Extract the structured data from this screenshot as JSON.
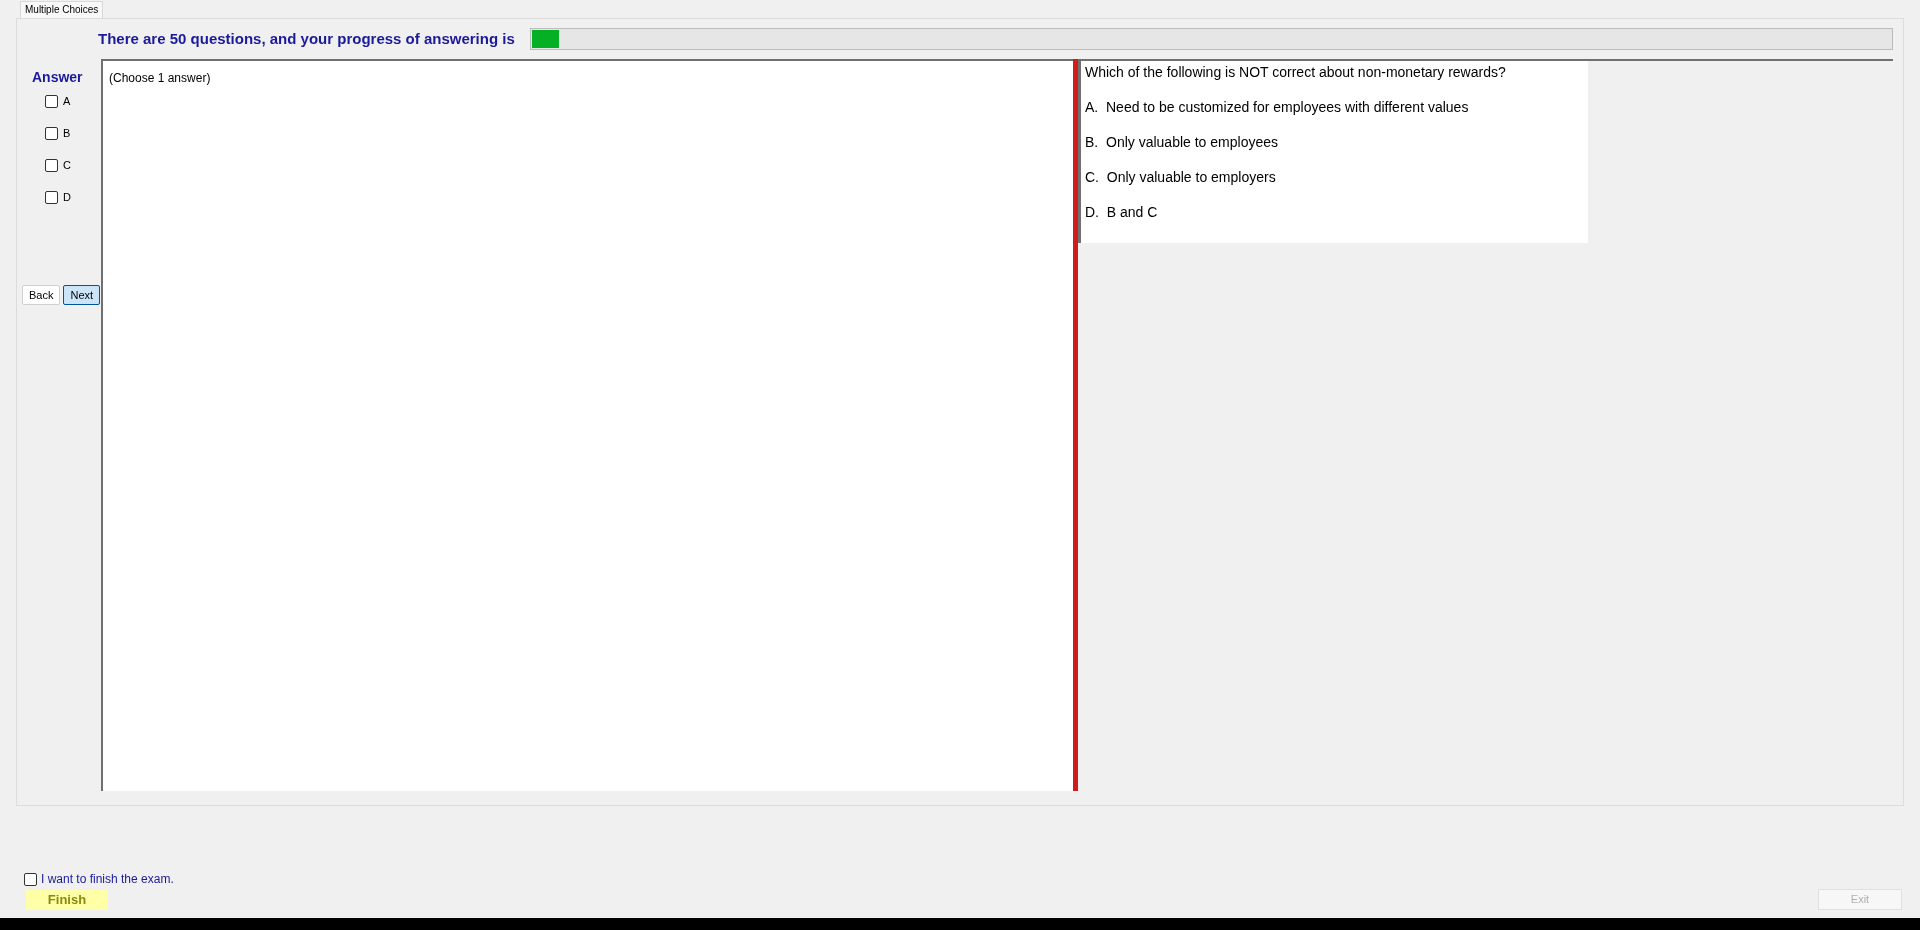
{
  "tab": {
    "label": "Multiple Choices",
    "selected": true
  },
  "progress": {
    "text": "There are 50 questions, and your progress of answering is",
    "level": 0.02
  },
  "answer": {
    "title": "Answer",
    "options": [
      {
        "label": "A",
        "checked": false
      },
      {
        "label": "B",
        "checked": false
      },
      {
        "label": "C",
        "checked": false
      },
      {
        "label": "D",
        "checked": false
      }
    ]
  },
  "nav_buttons": [
    {
      "label": "Back",
      "focused": false
    },
    {
      "label": "Next",
      "focused": true
    }
  ],
  "answer_panel": {
    "text": "(Choose 1 answer)"
  },
  "question": {
    "text": "Which of the following is NOT correct about non-monetary rewards?",
    "choices": [
      "A.  Need to be customized for employees with different values",
      "B.  Only valuable to employees",
      "C.  Only valuable to employers",
      "D.  B and C"
    ]
  },
  "finish": {
    "confirm_label": "I want to finish the exam.",
    "confirm_checked": false,
    "button": "Finish"
  },
  "exit": {
    "label": "Exit",
    "disabled": true
  }
}
